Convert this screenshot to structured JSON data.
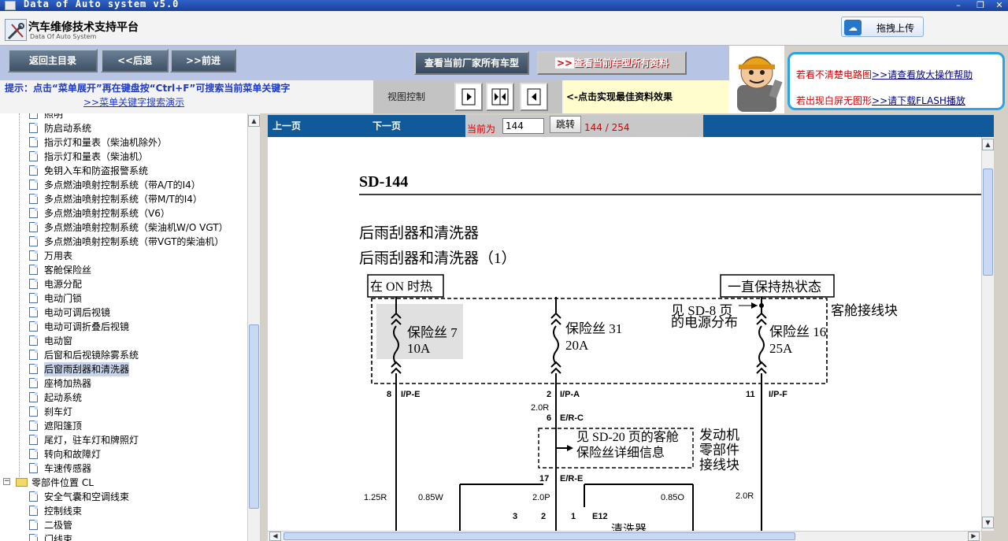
{
  "window": {
    "title": "Data of Auto system v5.0"
  },
  "header": {
    "brand": "汽车维修技术支持平台",
    "brand_sub": "Data Of Auto System",
    "upload_label": "拖拽上传"
  },
  "toolbar": {
    "home": "返回主目录",
    "back": "<<后退",
    "forward": ">>前进",
    "all_models": "查看当前厂家所有车型",
    "all_data": "查看当前车型所有资料",
    "hint": "提示：点击“菜单展开”再在键盘按“Ctrl+F”可搜索当前菜单关键字",
    "hint_link": ">>菜单关键字搜索演示",
    "view_control": "视图控制",
    "best_effect": "<-点击实现最佳资料效果"
  },
  "help": {
    "line1_prefix": "若看不清楚电路图",
    "line1_link": ">>请查看放大操作帮助",
    "line2_prefix": "若出现白屏无图形",
    "line2_link": ">>请下载FLASH播放"
  },
  "tree": {
    "items": [
      {
        "label": "照明"
      },
      {
        "label": "防启动系统"
      },
      {
        "label": "指示灯和量表（柴油机除外）"
      },
      {
        "label": "指示灯和量表（柴油机）"
      },
      {
        "label": "免钥入车和防盗报警系统"
      },
      {
        "label": "多点燃油喷射控制系统（带A/T的I4）"
      },
      {
        "label": "多点燃油喷射控制系统（带M/T的I4）"
      },
      {
        "label": "多点燃油喷射控制系统（V6）"
      },
      {
        "label": "多点燃油喷射控制系统（柴油机W/O VGT）"
      },
      {
        "label": "多点燃油喷射控制系统（带VGT的柴油机）"
      },
      {
        "label": "万用表"
      },
      {
        "label": "客舱保险丝"
      },
      {
        "label": "电源分配"
      },
      {
        "label": "电动门锁"
      },
      {
        "label": "电动可调后视镜"
      },
      {
        "label": "电动可调折叠后视镜"
      },
      {
        "label": "电动窗"
      },
      {
        "label": "后窗和后视镜除雾系统"
      },
      {
        "label": "后窗雨刮器和清洗器",
        "selected": true
      },
      {
        "label": "座椅加热器"
      },
      {
        "label": "起动系统"
      },
      {
        "label": "刹车灯"
      },
      {
        "label": "遮阳篷顶"
      },
      {
        "label": "尾灯，驻车灯和牌照灯"
      },
      {
        "label": "转向和故障灯"
      },
      {
        "label": "车速传感器"
      }
    ],
    "folder": "零部件位置 CL",
    "folder_items": [
      {
        "label": "安全气囊和空调线束"
      },
      {
        "label": "控制线束"
      },
      {
        "label": "二极管"
      },
      {
        "label": "门线束"
      }
    ]
  },
  "docnav": {
    "prev": "上一页",
    "next": "下一页",
    "current_label": "当前为",
    "page_input": "144",
    "go": "跳转",
    "page_count": "144 / 254"
  },
  "diagram": {
    "page_code": "SD-144",
    "title": "后雨刮器和清洗器",
    "subtitle": "后雨刮器和清洗器（1）",
    "box_on": "在 ON 时热",
    "box_always": "一直保持热状态",
    "see_power": "见 SD-8 页",
    "see_power2": "的电源分布",
    "cabin_block": "客舱接线块",
    "fuse7": "保险丝 7",
    "fuse7_amp": "10A",
    "fuse31": "保险丝 31",
    "fuse31_amp": "20A",
    "fuse16": "保险丝 16",
    "fuse16_amp": "25A",
    "pin8": "8",
    "pin8_conn": "I/P-E",
    "pin2": "2",
    "pin2_conn": "I/P-A",
    "pin11": "11",
    "pin11_conn": "I/P-F",
    "wire_20r": "2.0R",
    "pin6": "6",
    "pin6_conn": "E/R-C",
    "see_fuse1": "见 SD-20 页的客舱",
    "see_fuse2": "保险丝详细信息",
    "engine1": "发动机",
    "engine2": "零部件",
    "engine3": "接线块",
    "pin17": "17",
    "pin17_conn": "E/R-E",
    "w125r": "1.25R",
    "w085w": "0.85W",
    "w20p": "2.0P",
    "w085o": "0.85O",
    "w20r2": "2.0R",
    "p3": "3",
    "p2": "2",
    "p1": "1",
    "e12": "E12",
    "washer": "清洗器"
  }
}
